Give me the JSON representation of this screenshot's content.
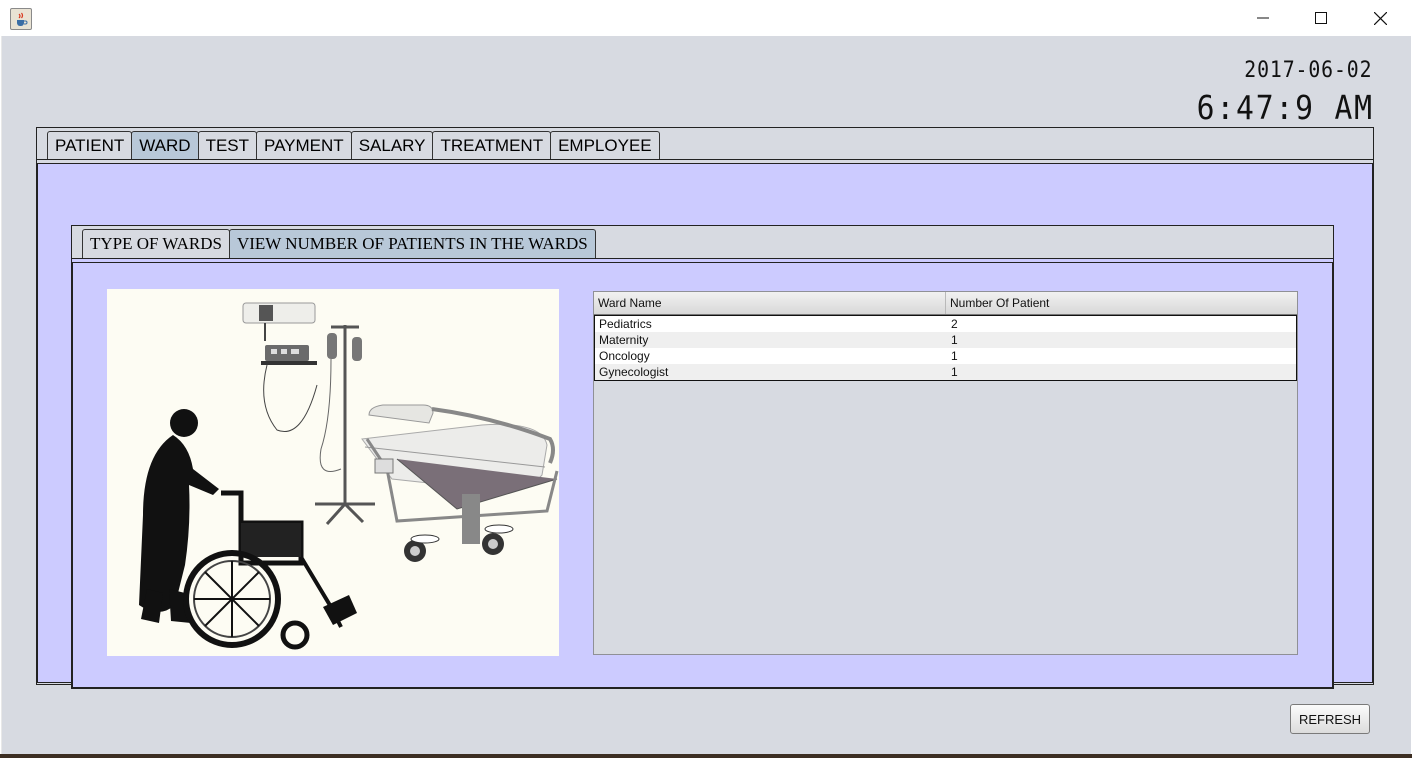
{
  "clock": {
    "date": "2017-06-02",
    "time": "6:47:9 AM"
  },
  "main_tabs": [
    "PATIENT",
    "WARD",
    "TEST",
    "PAYMENT",
    "SALARY",
    "TREATMENT",
    "EMPLOYEE"
  ],
  "sub_tabs": [
    "TYPE OF WARDS",
    "VIEW NUMBER OF PATIENTS IN THE WARDS"
  ],
  "table": {
    "headers": [
      "Ward Name",
      "Number Of Patient"
    ],
    "rows": [
      [
        "Pediatrics",
        "2"
      ],
      [
        "Maternity",
        "1"
      ],
      [
        "Oncology",
        "1"
      ],
      [
        "Gynecologist",
        "1"
      ]
    ]
  },
  "refresh_label": "REFRESH",
  "colors": {
    "content_bg": "#cccbff",
    "frame_bg": "#d7dae1",
    "active_tab": "#b8c8d8"
  }
}
